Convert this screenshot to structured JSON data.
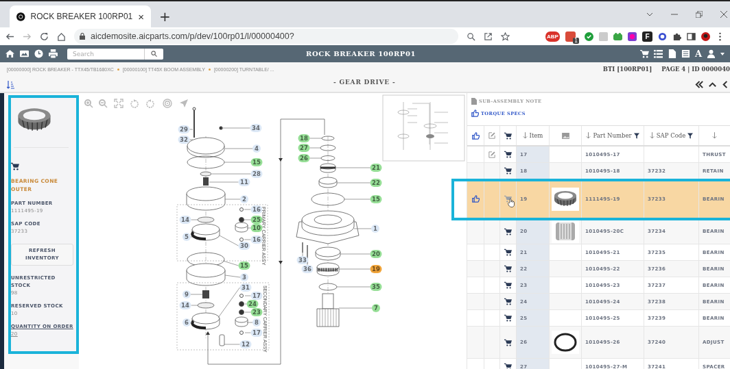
{
  "browser": {
    "tab_title": "ROCK BREAKER 100RP01",
    "close_tab": "×",
    "new_tab": "+",
    "url": "aicdemosite.aicparts.com/p/dev/100rp01/l/00000400?",
    "extension_abp": "ABP",
    "extension_badge": "1",
    "extension_f": "F"
  },
  "toolbar": {
    "search_placeholder": "Search",
    "title": "ROCK BREAKER 100RP01",
    "font_button": "A"
  },
  "breadcrumb": [
    "[00000000] ROCK BREAKER - TTX45/TB1680XC",
    "[00000100] TT45X BOOM ASSEMBLY",
    "[00000200] TURNTABLE/ ..."
  ],
  "page_info": {
    "book": "BTI [100RP01]",
    "page": "PAGE 4 | ID 0000040"
  },
  "page_title": "- GEAR DRIVE -",
  "part_panel": {
    "name": "BEARING CONE OUTER",
    "refresh_button": "REFRESH INVENTORY",
    "fields": [
      {
        "label": "PART NUMBER",
        "value": "1111495-19",
        "kind": "plain"
      },
      {
        "label": "SAP CODE",
        "value": "37233",
        "kind": "plain"
      }
    ],
    "stock": [
      {
        "label": "UNRESTRICTED STOCK",
        "value": "98",
        "kind": "plain"
      },
      {
        "label": "RESERVED STOCK",
        "value": "10",
        "kind": "plain"
      },
      {
        "label": "QUANTITY ON ORDER",
        "value": "20",
        "kind": "link"
      }
    ]
  },
  "diagram": {
    "assemblies": [
      "PRIMARY CARRIER ASSY",
      "SECONDARY CARRIER ASSY"
    ],
    "callouts": [
      {
        "label": "29",
        "color": "#dce8f6"
      },
      {
        "label": "32",
        "color": "#dce8f6"
      },
      {
        "label": "34",
        "color": "#dce8f6"
      },
      {
        "label": "4",
        "color": "#dce8f6"
      },
      {
        "label": "15",
        "color": "#97df97"
      },
      {
        "label": "28",
        "color": "#dce8f6"
      },
      {
        "label": "11",
        "color": "#dce8f6"
      },
      {
        "label": "2",
        "color": "#dce8f6"
      },
      {
        "label": "16",
        "color": "#dce8f6"
      },
      {
        "label": "25",
        "color": "#97df97"
      },
      {
        "label": "10",
        "color": "#97df97"
      },
      {
        "label": "14",
        "color": "#dce8f6"
      },
      {
        "label": "5",
        "color": "#dce8f6"
      },
      {
        "label": "16",
        "color": "#dce8f6"
      },
      {
        "label": "30",
        "color": "#dce8f6"
      },
      {
        "label": "15",
        "color": "#97df97"
      },
      {
        "label": "3",
        "color": "#dce8f6"
      },
      {
        "label": "31",
        "color": "#dce8f6"
      },
      {
        "label": "17",
        "color": "#dce8f6"
      },
      {
        "label": "24",
        "color": "#97df97"
      },
      {
        "label": "9",
        "color": "#dce8f6"
      },
      {
        "label": "14",
        "color": "#dce8f6"
      },
      {
        "label": "23",
        "color": "#97df97"
      },
      {
        "label": "6",
        "color": "#dce8f6"
      },
      {
        "label": "8",
        "color": "#dce8f6"
      },
      {
        "label": "17",
        "color": "#dce8f6"
      },
      {
        "label": "12",
        "color": "#dce8f6"
      },
      {
        "label": "18",
        "color": "#97df97"
      },
      {
        "label": "27",
        "color": "#97df97"
      },
      {
        "label": "26",
        "color": "#97df97"
      },
      {
        "label": "21",
        "color": "#97df97"
      },
      {
        "label": "22",
        "color": "#97df97"
      },
      {
        "label": "15",
        "color": "#97df97"
      },
      {
        "label": "1",
        "color": "#dce8f6"
      },
      {
        "label": "20",
        "color": "#97df97"
      },
      {
        "label": "33",
        "color": "#dce8f6"
      },
      {
        "label": "36",
        "color": "#dce8f6"
      },
      {
        "label": "19",
        "color": "#f0a43a"
      },
      {
        "label": "35",
        "color": "#97df97"
      },
      {
        "label": "7",
        "color": "#97df97"
      }
    ]
  },
  "table": {
    "notes": [
      {
        "kind": "note",
        "label": "SUB-ASSEMBLY NOTE"
      },
      {
        "kind": "link",
        "label": "TORQUE SPECS"
      }
    ],
    "columns": [
      {
        "kind": "like"
      },
      {
        "kind": "edit"
      },
      {
        "kind": "cart"
      },
      {
        "kind": "sort",
        "label": "Item"
      },
      {
        "kind": "image"
      },
      {
        "kind": "sort_filter",
        "label": "Part Number"
      },
      {
        "kind": "sort_filter",
        "label": "SAP Code"
      },
      {
        "kind": "sort"
      }
    ],
    "rows": [
      {
        "kind": "plain",
        "item": "17",
        "part_number": "1010495-17",
        "column_8": "THRUST",
        "selected": false,
        "liked": false,
        "editable": true,
        "hovered": false
      },
      {
        "kind": "plain",
        "item": "18",
        "part_number": "1010495-18",
        "sap_code": "37232",
        "column_8": "RETAIN",
        "selected": false,
        "liked": false,
        "editable": false,
        "hovered": false
      },
      {
        "kind": "tapered_bearing",
        "item": "19",
        "part_number": "1111495-19",
        "sap_code": "37233",
        "column_8": "BEARIN",
        "selected": true,
        "liked": true,
        "editable": false,
        "hovered": true
      },
      {
        "kind": "needle_bearing",
        "item": "20",
        "part_number": "1010495-20C",
        "sap_code": "37234",
        "column_8": "BEARIN",
        "selected": false,
        "liked": false,
        "editable": false,
        "hovered": false
      },
      {
        "kind": "plain",
        "item": "21",
        "part_number": "1010495-21",
        "sap_code": "37235",
        "column_8": "BEARIN",
        "selected": false,
        "liked": false,
        "editable": false,
        "hovered": false
      },
      {
        "kind": "plain",
        "item": "22",
        "part_number": "1010495-22",
        "sap_code": "37236",
        "column_8": "BEARIN",
        "selected": false,
        "liked": false,
        "editable": false,
        "hovered": false
      },
      {
        "kind": "plain",
        "item": "23",
        "part_number": "1010495-23",
        "sap_code": "37237",
        "column_8": "BEARIN",
        "selected": false,
        "liked": false,
        "editable": false,
        "hovered": false
      },
      {
        "kind": "plain",
        "item": "24",
        "part_number": "1010495-24",
        "sap_code": "37238",
        "column_8": "BEARIN",
        "selected": false,
        "liked": false,
        "editable": false,
        "hovered": false
      },
      {
        "kind": "plain",
        "item": "25",
        "part_number": "1010495-25",
        "sap_code": "37239",
        "column_8": "BEARIN",
        "selected": false,
        "liked": false,
        "editable": false,
        "hovered": false
      },
      {
        "kind": "o_ring",
        "item": "26",
        "part_number": "1010495-26",
        "sap_code": "37240",
        "column_8": "ADJUST",
        "selected": false,
        "liked": false,
        "editable": false,
        "hovered": false
      },
      {
        "kind": "plain",
        "item": "27",
        "part_number": "1010495-27-M",
        "sap_code": "37241",
        "column_8": "SPACER",
        "selected": false,
        "liked": false,
        "editable": false,
        "hovered": false
      }
    ]
  }
}
